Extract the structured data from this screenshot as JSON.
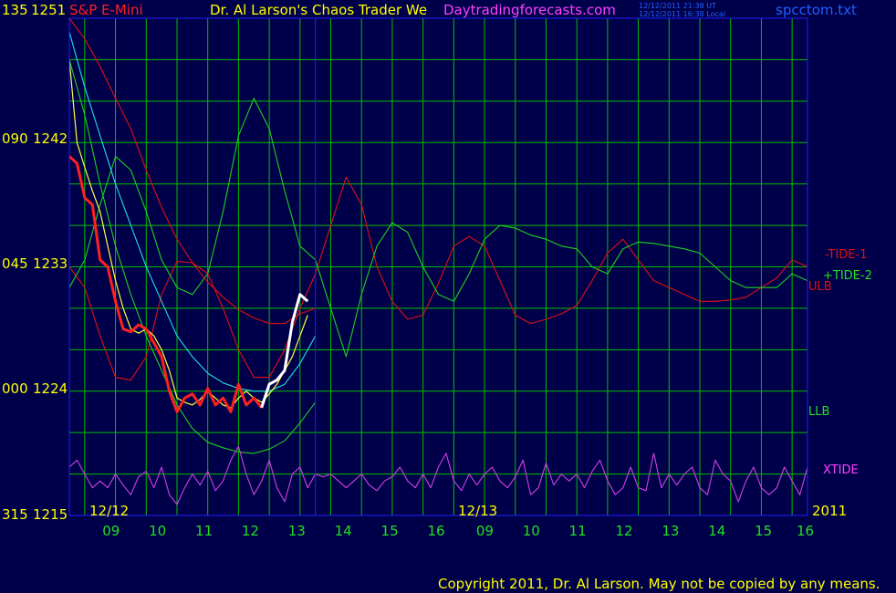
{
  "header": {
    "symbol": "S&P E-Mini",
    "title": "Dr. Al Larson's Chaos Trader We",
    "site": "Daytradingforecasts.com",
    "timestamp_ut": "12/12/2011 21:38 UT",
    "timestamp_local": "12/12/2011 16:38 Local",
    "filename": "spcctom.txt"
  },
  "footer": {
    "copyright": "Copyright 2011, Dr. Al Larson. May not be copied by any means."
  },
  "colors": {
    "background": "#00004a",
    "grid": "#00c000",
    "frame": "#2020ff",
    "tide1": "#e01010",
    "tide2": "#20d020",
    "ulb": "#e01010",
    "llb": "#20d020",
    "xtide": "#d040e0",
    "cyan_avg": "#20e0e0",
    "yellow_avg": "#ffff40",
    "price_day1": "#ff2020",
    "price_day2": "#ffffff"
  },
  "chart_data": {
    "type": "line",
    "title": "S&P E-Mini",
    "y_axis": {
      "price_labels": [
        "1251",
        "1242",
        "1233",
        "1224",
        "1215"
      ],
      "angle_labels": [
        "135",
        "090",
        "045",
        "000",
        "315"
      ],
      "ylim": [
        1215,
        1251
      ]
    },
    "x_axis": {
      "day_labels": [
        "12/12",
        "12/13",
        "2011"
      ],
      "hour_labels": [
        "09",
        "10",
        "11",
        "12",
        "13",
        "14",
        "15",
        "16",
        "09",
        "10",
        "11",
        "12",
        "13",
        "14",
        "15",
        "16"
      ],
      "xlim": [
        8.5,
        32.5
      ],
      "day_split": 16.5
    },
    "series_labels": {
      "tide1": "-TIDE-1",
      "tide2": "+TIDE-2",
      "ulb": "ULB",
      "llb": "LLB",
      "xtide": "XTIDE"
    },
    "series": [
      {
        "key": "tide1",
        "name": "-TIDE-1",
        "x": [
          8.5,
          9.0,
          9.5,
          10.0,
          10.5,
          11.0,
          11.5,
          12.0,
          12.5,
          13.0,
          13.5,
          14.0,
          14.5,
          15.0,
          15.5,
          16.0,
          16.5,
          17.0,
          17.5,
          18.0,
          18.5,
          19.0,
          19.5,
          20.0,
          20.5,
          21.0,
          21.5,
          22.0,
          22.5,
          23.0,
          23.5,
          24.0,
          24.5,
          25.0,
          25.5,
          26.0,
          26.5,
          27.0,
          27.5,
          28.0,
          28.5,
          29.0,
          29.5,
          30.0,
          30.5,
          31.0,
          31.5,
          32.0,
          32.5
        ],
        "y": [
          1233.0,
          1231.5,
          1228.0,
          1225.0,
          1224.8,
          1226.5,
          1231.0,
          1233.4,
          1233.3,
          1232.5,
          1230.0,
          1227.0,
          1225.0,
          1225.0,
          1227.0,
          1230.0,
          1232.5,
          1236.0,
          1239.5,
          1237.5,
          1233.0,
          1230.5,
          1229.2,
          1229.5,
          1231.8,
          1234.5,
          1235.2,
          1234.5,
          1232.0,
          1229.5,
          1228.9,
          1229.2,
          1229.6,
          1230.2,
          1232.0,
          1234.0,
          1235.0,
          1233.5,
          1232.0,
          1231.5,
          1231.0,
          1230.5,
          1230.5,
          1230.6,
          1230.8,
          1231.5,
          1232.2,
          1233.5,
          1233.0
        ]
      },
      {
        "key": "tide2",
        "name": "+TIDE-2",
        "x": [
          8.5,
          9.0,
          9.5,
          10.0,
          10.5,
          11.0,
          11.5,
          12.0,
          12.5,
          13.0,
          13.5,
          14.0,
          14.5,
          15.0,
          15.5,
          16.0,
          16.5,
          17.0,
          17.5,
          18.0,
          18.5,
          19.0,
          19.5,
          20.0,
          20.5,
          21.0,
          21.5,
          22.0,
          22.5,
          23.0,
          23.5,
          24.0,
          24.5,
          25.0,
          25.5,
          26.0,
          26.5,
          27.0,
          27.5,
          28.0,
          28.5,
          29.0,
          29.5,
          30.0,
          30.5,
          31.0,
          31.5,
          32.0,
          32.5
        ],
        "y": [
          1231.5,
          1233.5,
          1237.5,
          1241.0,
          1240.0,
          1237.0,
          1233.5,
          1231.5,
          1231.0,
          1232.5,
          1237.0,
          1242.5,
          1245.2,
          1243.0,
          1238.5,
          1234.5,
          1233.5,
          1230.0,
          1226.5,
          1231.0,
          1234.5,
          1236.2,
          1235.5,
          1233.0,
          1231.0,
          1230.5,
          1232.5,
          1235.0,
          1236.0,
          1235.8,
          1235.3,
          1235.0,
          1234.5,
          1234.3,
          1233.0,
          1232.5,
          1234.3,
          1234.8,
          1234.7,
          1234.5,
          1234.3,
          1234.0,
          1233.0,
          1232.0,
          1231.5,
          1231.5,
          1231.5,
          1232.5,
          1232.0
        ]
      },
      {
        "key": "ulb",
        "name": "ULB",
        "x": [
          8.5,
          9.0,
          9.5,
          10.0,
          10.5,
          11.0,
          11.5,
          12.0,
          12.5,
          13.0,
          13.5,
          14.0,
          14.5,
          15.0,
          15.5,
          16.0,
          16.5
        ],
        "y": [
          1251.0,
          1249.5,
          1247.5,
          1245.2,
          1243.0,
          1240.0,
          1237.3,
          1235.0,
          1233.3,
          1231.9,
          1230.8,
          1229.9,
          1229.3,
          1228.9,
          1228.9,
          1229.6,
          1230.0
        ]
      },
      {
        "key": "llb",
        "name": "LLB",
        "x": [
          8.5,
          9.0,
          9.5,
          10.0,
          10.5,
          11.0,
          11.5,
          12.0,
          12.5,
          13.0,
          13.5,
          14.0,
          14.5,
          15.0,
          15.5,
          16.0,
          16.5
        ],
        "y": [
          1248.0,
          1244.0,
          1239.0,
          1234.5,
          1231.0,
          1228.0,
          1225.5,
          1223.0,
          1221.3,
          1220.3,
          1219.9,
          1219.6,
          1219.5,
          1219.8,
          1220.4,
          1221.7,
          1223.2
        ]
      },
      {
        "key": "cyan_avg",
        "name": "",
        "x": [
          8.5,
          9.0,
          9.5,
          10.0,
          10.5,
          11.0,
          11.5,
          12.0,
          12.5,
          13.0,
          13.5,
          14.0,
          14.5,
          15.0,
          15.5,
          16.0,
          16.5
        ],
        "y": [
          1250.0,
          1246.0,
          1242.5,
          1239.0,
          1236.0,
          1233.0,
          1230.5,
          1228.0,
          1226.5,
          1225.3,
          1224.6,
          1224.2,
          1224.0,
          1224.0,
          1224.5,
          1226.0,
          1228.0
        ]
      },
      {
        "key": "yellow_avg",
        "name": "",
        "x": [
          8.5,
          8.75,
          9.0,
          9.25,
          9.5,
          9.75,
          10.0,
          10.25,
          10.5,
          10.75,
          11.0,
          11.25,
          11.5,
          11.75,
          12.0,
          12.25,
          12.5,
          12.75,
          13.0,
          13.25,
          13.5,
          13.75,
          14.0,
          14.25,
          14.5,
          14.75,
          15.0,
          15.25,
          15.5,
          15.75,
          16.0,
          16.25
        ],
        "y": [
          1248.0,
          1242.0,
          1240.2,
          1238.5,
          1237.0,
          1234.5,
          1232.0,
          1230.0,
          1228.5,
          1228.2,
          1228.5,
          1228.0,
          1227.0,
          1225.5,
          1223.5,
          1223.2,
          1223.0,
          1223.4,
          1224.0,
          1223.5,
          1223.0,
          1222.8,
          1223.5,
          1224.0,
          1223.5,
          1223.2,
          1223.8,
          1224.5,
          1225.5,
          1226.5,
          1228.0,
          1229.5
        ]
      },
      {
        "key": "xtide",
        "name": "XTIDE",
        "x": [
          8.5,
          8.75,
          9.0,
          9.25,
          9.5,
          9.75,
          10.0,
          10.25,
          10.5,
          10.75,
          11.0,
          11.25,
          11.5,
          11.75,
          12.0,
          12.25,
          12.5,
          12.75,
          13.0,
          13.25,
          13.5,
          13.75,
          14.0,
          14.25,
          14.5,
          14.75,
          15.0,
          15.25,
          15.5,
          15.75,
          16.0,
          16.25,
          16.5,
          16.75,
          17.0,
          17.25,
          17.5,
          17.75,
          18.0,
          18.25,
          18.5,
          18.75,
          19.0,
          19.25,
          19.5,
          19.75,
          20.0,
          20.25,
          20.5,
          20.75,
          21.0,
          21.25,
          21.5,
          21.75,
          22.0,
          22.25,
          22.5,
          22.75,
          23.0,
          23.25,
          23.5,
          23.75,
          24.0,
          24.25,
          24.5,
          24.75,
          25.0,
          25.25,
          25.5,
          25.75,
          26.0,
          26.25,
          26.5,
          26.75,
          27.0,
          27.25,
          27.5,
          27.75,
          28.0,
          28.25,
          28.5,
          28.75,
          29.0,
          29.25,
          29.5,
          29.75,
          30.0,
          30.25,
          30.5,
          30.75,
          31.0,
          31.25,
          31.5,
          31.75,
          32.0,
          32.25,
          32.5
        ],
        "y": [
          1218.5,
          1219.0,
          1218.0,
          1217.0,
          1217.5,
          1217.0,
          1218.0,
          1217.2,
          1216.5,
          1217.8,
          1218.2,
          1217.0,
          1218.5,
          1216.5,
          1215.8,
          1217.0,
          1218.0,
          1217.2,
          1218.2,
          1216.8,
          1217.5,
          1219.0,
          1220.0,
          1218.0,
          1216.5,
          1217.5,
          1219.0,
          1217.0,
          1216.0,
          1218.0,
          1218.5,
          1217.0,
          1218.0,
          1217.8,
          1218.0,
          1217.5,
          1217.0,
          1217.5,
          1218.0,
          1217.2,
          1216.8,
          1217.5,
          1217.8,
          1218.5,
          1217.5,
          1217.0,
          1218.0,
          1217.0,
          1218.5,
          1219.5,
          1217.5,
          1216.8,
          1218.0,
          1217.2,
          1218.0,
          1218.5,
          1217.5,
          1217.0,
          1217.8,
          1219.0,
          1216.5,
          1217.0,
          1218.8,
          1217.2,
          1218.0,
          1217.5,
          1218.0,
          1217.0,
          1218.2,
          1219.0,
          1217.5,
          1216.5,
          1217.0,
          1218.5,
          1217.0,
          1216.8,
          1219.5,
          1217.0,
          1218.0,
          1217.2,
          1218.0,
          1218.5,
          1217.0,
          1216.5,
          1219.0,
          1218.0,
          1217.5,
          1216.0,
          1217.5,
          1218.5,
          1217.0,
          1216.5,
          1217.0,
          1218.5,
          1217.5,
          1216.5,
          1218.5
        ]
      },
      {
        "key": "price_day1",
        "name": "",
        "x": [
          8.5,
          8.75,
          9.0,
          9.25,
          9.5,
          9.75,
          10.0,
          10.25,
          10.5,
          10.75,
          11.0,
          11.25,
          11.5,
          11.75,
          12.0,
          12.25,
          12.5,
          12.75,
          13.0,
          13.25,
          13.5,
          13.75,
          14.0,
          14.25,
          14.5,
          14.75
        ],
        "y": [
          1241.0,
          1240.5,
          1238.0,
          1237.5,
          1233.5,
          1233.0,
          1230.5,
          1228.5,
          1228.3,
          1228.8,
          1228.5,
          1227.5,
          1226.5,
          1224.0,
          1222.5,
          1223.5,
          1223.8,
          1223.0,
          1224.2,
          1223.0,
          1223.5,
          1222.5,
          1224.5,
          1223.0,
          1223.5,
          1222.8
        ]
      },
      {
        "key": "price_day2",
        "name": "",
        "x": [
          14.75,
          15.0,
          15.25,
          15.5,
          15.75,
          16.0,
          16.25
        ],
        "y": [
          1222.8,
          1224.5,
          1224.8,
          1225.5,
          1229.0,
          1231.0,
          1230.5
        ]
      }
    ]
  }
}
